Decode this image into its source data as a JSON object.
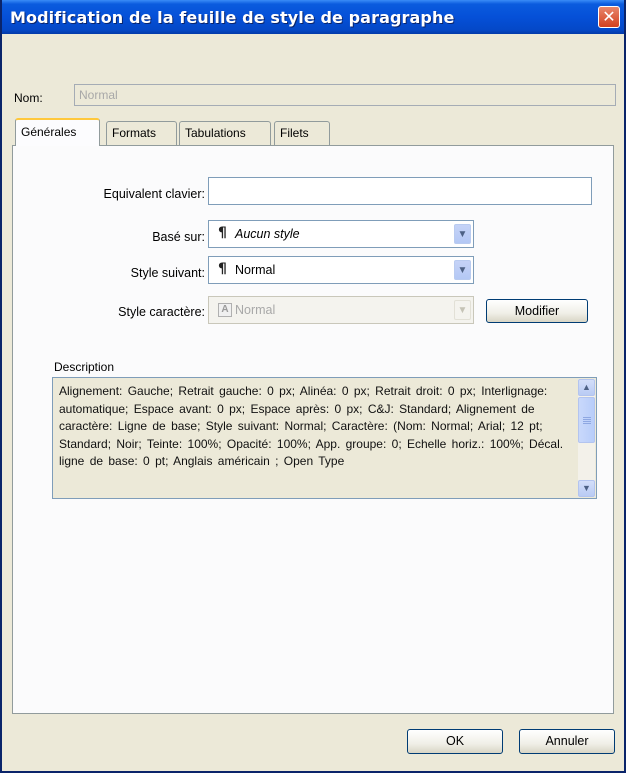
{
  "window": {
    "title": "Modification de la feuille de style de paragraphe",
    "close_glyph": "✕"
  },
  "name": {
    "label": "Nom:",
    "value": "Normal"
  },
  "tabs": [
    {
      "label": "Générales",
      "active": true
    },
    {
      "label": "Formats",
      "active": false
    },
    {
      "label": "Tabulations",
      "active": false
    },
    {
      "label": "Filets",
      "active": false
    }
  ],
  "form": {
    "keyboard_label": "Equivalent clavier:",
    "keyboard_value": "",
    "based_on_label": "Basé sur:",
    "based_on_value": "Aucun style",
    "next_style_label": "Style suivant:",
    "next_style_value": "Normal",
    "char_style_label": "Style caractère:",
    "char_style_value": "Normal",
    "modify_button": "Modifier",
    "paragraph_icon": "pilcrow-icon",
    "char_icon_letter": "A"
  },
  "description": {
    "label": "Description",
    "text": "Alignement: Gauche; Retrait gauche: 0 px; Alinéa: 0 px; Retrait droit: 0 px; Interlignage: automatique; Espace avant: 0 px; Espace après: 0 px; C&J: Standard; Alignement de caractère: Ligne de base; Style suivant: Normal; Caractère: (Nom: Normal; Arial; 12 pt; Standard; Noir; Teinte: 100%; Opacité: 100%; App. groupe: 0; Echelle horiz.: 100%; Décal. ligne de base: 0 pt; Anglais américain ; Open Type"
  },
  "buttons": {
    "ok": "OK",
    "cancel": "Annuler"
  },
  "colors": {
    "title_bar": "#0550d8",
    "dialog_bg": "#ece9d8",
    "active_tab_accent": "#ffc83c",
    "close_button": "#d3401e"
  }
}
